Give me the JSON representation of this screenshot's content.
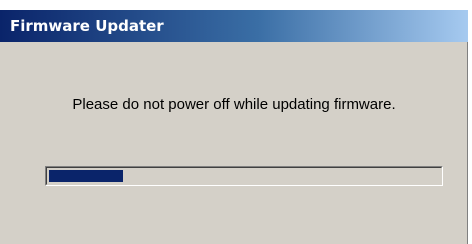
{
  "window": {
    "title": "Firmware Updater"
  },
  "dialog": {
    "message": "Please do not power off while updating firmware."
  },
  "progress": {
    "fraction": 0.19,
    "fill_color": "#0a246a"
  },
  "colors": {
    "titlebar_start": "#0a246a",
    "titlebar_end": "#a6caf0",
    "window_background": "#d4d0c8"
  }
}
